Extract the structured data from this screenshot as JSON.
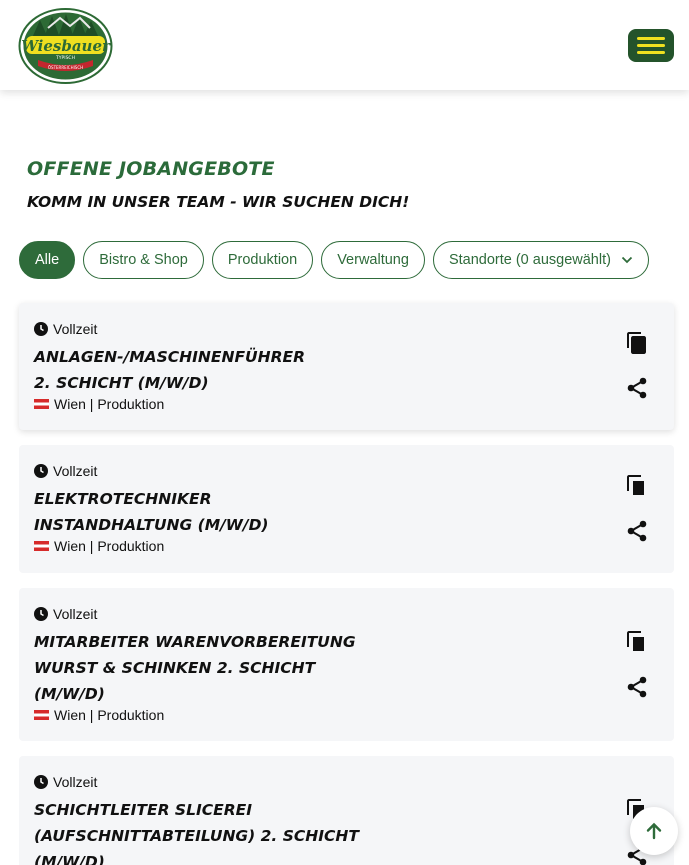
{
  "header": {
    "logo_text": "Wiesbauer",
    "logo_sub1": "TYPISCH",
    "logo_sub2": "ÖSTERREICHISCH"
  },
  "page": {
    "title": "Offene Jobangebote",
    "subtitle": "Komm in unser Team - wir suchen dich!"
  },
  "filters": [
    {
      "label": "Alle",
      "active": true
    },
    {
      "label": "Bistro & Shop",
      "active": false
    },
    {
      "label": "Produktion",
      "active": false
    },
    {
      "label": "Verwaltung",
      "active": false
    },
    {
      "label": "Standorte (0 ausgewählt)",
      "active": false
    }
  ],
  "jobs": [
    {
      "type": "Vollzeit",
      "title_lines": [
        "Anlagen-/Maschinenführer",
        "2. Schicht (m/w/d)"
      ],
      "location": "Wien | Produktion"
    },
    {
      "type": "Vollzeit",
      "title_lines": [
        "Elektrotechniker",
        "Instandhaltung (m/w/d)"
      ],
      "location": "Wien | Produktion"
    },
    {
      "type": "Vollzeit",
      "title_lines": [
        "Mitarbeiter Warenvorbereitung",
        "Wurst & Schinken 2. Schicht",
        "(m/w/d)"
      ],
      "location": "Wien | Produktion"
    },
    {
      "type": "Vollzeit",
      "title_lines": [
        "Schichtleiter Slicerei",
        "(Aufschnittabteilung) 2. Schicht",
        "(m/w/d)"
      ],
      "location": ""
    }
  ],
  "colors": {
    "brand_green": "#2e6b3a",
    "menu_yellow": "#f0e020",
    "card_bg": "#f5f6f8"
  },
  "icons": {
    "menu": "hamburger-icon",
    "type": "clock-icon",
    "copy": "copy-icon",
    "share": "share-icon",
    "dropdown": "chevron-down-icon",
    "back_to_top": "arrow-up-icon",
    "flag": "austria-flag-icon"
  }
}
